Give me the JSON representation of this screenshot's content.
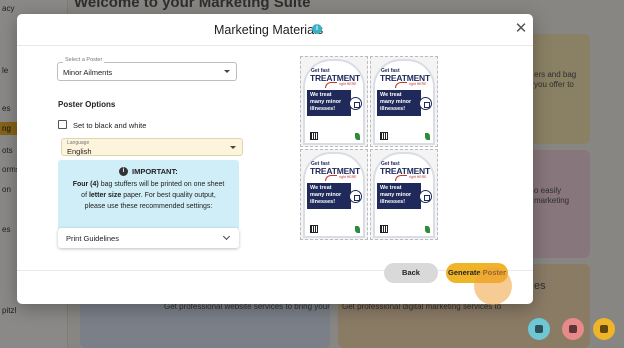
{
  "background": {
    "page_title": "Welcome to your Marketing Suite",
    "sidebar_items": [
      "acy",
      "le",
      "es",
      "ng",
      "ots",
      "orms",
      "on",
      "es",
      "pitzl"
    ],
    "card_texts": [
      "ers and bag",
      "you offer to",
      "o easily",
      "marketing",
      "es",
      "Get professional website services to bring your",
      "Get professional digital marketing services to"
    ]
  },
  "modal": {
    "title": "Marketing Materials",
    "close_icon": "close-icon",
    "select": {
      "label": "Select a Poster",
      "value": "Minor Ailments"
    },
    "poster_options_heading": "Poster Options",
    "bw_checkbox": {
      "label": "Set to black and white",
      "checked": false
    },
    "language": {
      "label": "Language",
      "value": "English"
    },
    "notice": {
      "icon": "info-icon",
      "title": "IMPORTANT:",
      "line1_bold": "Four (4)",
      "line1_rest": " bag stuffers will be printed on one sheet",
      "line2_pre": "of ",
      "line2_bold": "letter size",
      "line2_rest": " paper. For best quality output,",
      "line3": "please use these recommended settings:"
    },
    "print_guidelines": "Print Guidelines",
    "poster": {
      "get_fast": "Get fast",
      "treatment": "TREATMENT",
      "right_here": "right HERE",
      "band_lines": [
        "We treat",
        "many minor",
        "illnesses!"
      ]
    },
    "buttons": {
      "back": "Back",
      "generate": "Generate Poster"
    }
  },
  "colors": {
    "accent": "#f0b429",
    "notice_bg": "#cfeef7",
    "poster_navy": "#1f2a5a"
  }
}
